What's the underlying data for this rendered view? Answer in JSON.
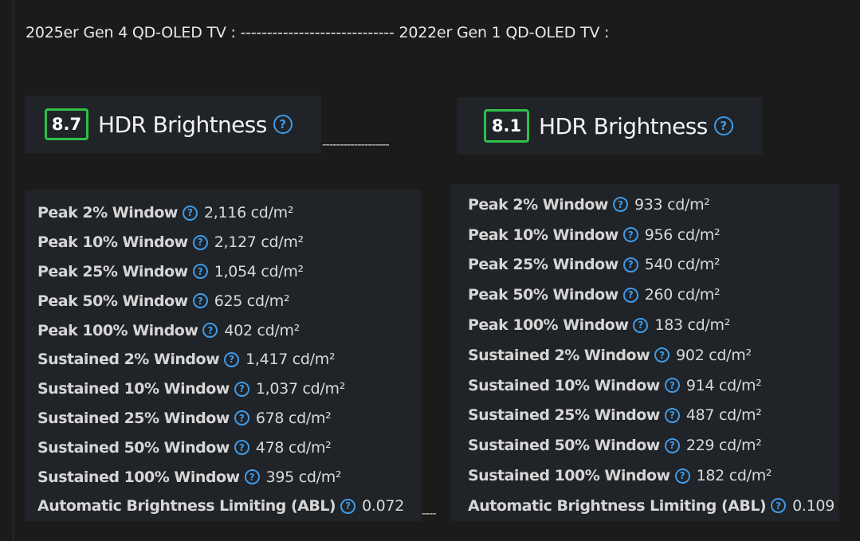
{
  "heading": {
    "left": "2025er Gen 4 QD-OLED TV :",
    "dashes": "-----------------------------",
    "right": "2022er Gen 1 QD-OLED TV :"
  },
  "help_glyph": "?",
  "separators": {
    "middle": "-------------------",
    "bottom": "----"
  },
  "left_card": {
    "score": "8.7",
    "title": "HDR Brightness",
    "rows": [
      {
        "label": "Peak 2% Window",
        "value": "2,116 cd/m²"
      },
      {
        "label": "Peak 10% Window",
        "value": "2,127 cd/m²"
      },
      {
        "label": "Peak 25% Window",
        "value": "1,054 cd/m²"
      },
      {
        "label": "Peak 50% Window",
        "value": "625 cd/m²"
      },
      {
        "label": "Peak 100% Window",
        "value": "402 cd/m²"
      },
      {
        "label": "Sustained 2% Window",
        "value": "1,417 cd/m²"
      },
      {
        "label": "Sustained 10% Window",
        "value": "1,037 cd/m²"
      },
      {
        "label": "Sustained 25% Window",
        "value": "678 cd/m²"
      },
      {
        "label": "Sustained 50% Window",
        "value": "478 cd/m²"
      },
      {
        "label": "Sustained 100% Window",
        "value": "395 cd/m²"
      },
      {
        "label": "Automatic Brightness Limiting (ABL)",
        "value": "0.072"
      }
    ]
  },
  "right_card": {
    "score": "8.1",
    "title": "HDR Brightness",
    "rows": [
      {
        "label": "Peak 2% Window",
        "value": "933 cd/m²"
      },
      {
        "label": "Peak 10% Window",
        "value": "956 cd/m²"
      },
      {
        "label": "Peak 25% Window",
        "value": "540 cd/m²"
      },
      {
        "label": "Peak 50% Window",
        "value": "260 cd/m²"
      },
      {
        "label": "Peak 100% Window",
        "value": "183 cd/m²"
      },
      {
        "label": "Sustained 2% Window",
        "value": "902 cd/m²"
      },
      {
        "label": "Sustained 10% Window",
        "value": "914 cd/m²"
      },
      {
        "label": "Sustained 25% Window",
        "value": "487 cd/m²"
      },
      {
        "label": "Sustained 50% Window",
        "value": "229 cd/m²"
      },
      {
        "label": "Sustained 100% Window",
        "value": "182 cd/m²"
      },
      {
        "label": "Automatic Brightness Limiting (ABL)",
        "value": "0.109"
      }
    ]
  },
  "colors": {
    "background": "#1b1b1b",
    "card": "#202327",
    "badge_border": "#2fbf4a",
    "help_icon": "#3d9be9"
  }
}
